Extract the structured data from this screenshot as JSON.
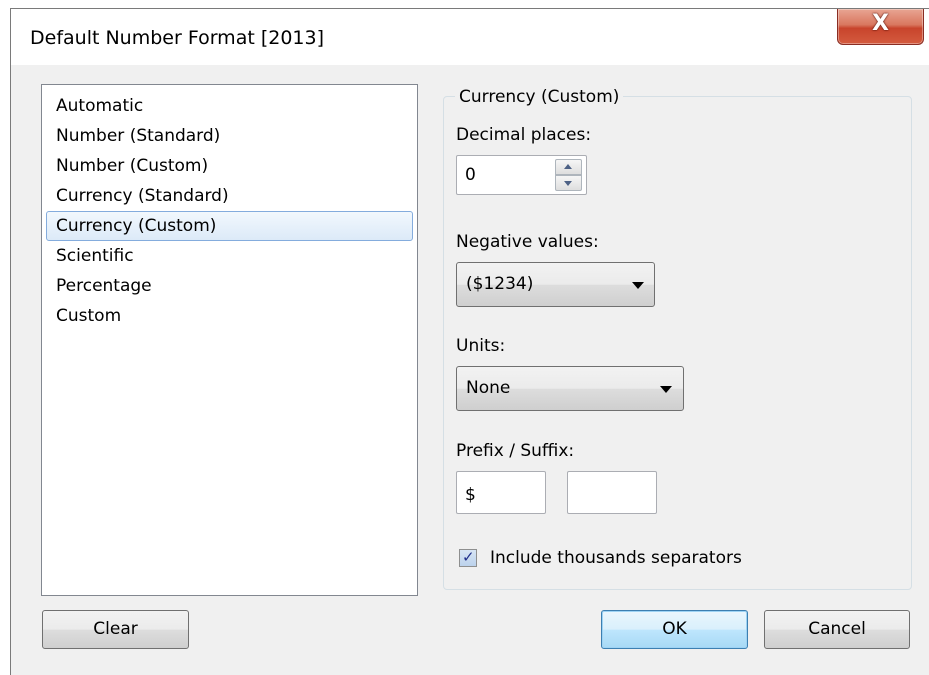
{
  "window": {
    "title": "Default Number Format [2013]",
    "close_glyph": "X"
  },
  "format_list": {
    "items": [
      {
        "label": "Automatic"
      },
      {
        "label": "Number (Standard)"
      },
      {
        "label": "Number (Custom)"
      },
      {
        "label": "Currency (Standard)"
      },
      {
        "label": "Currency (Custom)"
      },
      {
        "label": "Scientific"
      },
      {
        "label": "Percentage"
      },
      {
        "label": "Custom"
      }
    ],
    "selected": "Currency (Custom)"
  },
  "options": {
    "group_title": "Currency (Custom)",
    "decimal_places": {
      "label": "Decimal places:",
      "value": "0"
    },
    "negative_values": {
      "label": "Negative values:",
      "selected": "($1234)"
    },
    "units": {
      "label": "Units:",
      "selected": "None"
    },
    "prefix_suffix": {
      "label": "Prefix / Suffix:",
      "prefix": "$",
      "suffix": ""
    },
    "thousands_separators": {
      "label": "Include thousands separators",
      "checked": true,
      "check_glyph": "✓"
    }
  },
  "buttons": {
    "clear": "Clear",
    "ok": "OK",
    "cancel": "Cancel"
  },
  "icons": {
    "close": "close-icon",
    "spin_up": "chevron-up-icon",
    "spin_down": "chevron-down-icon",
    "dropdown": "dropdown-arrow-icon",
    "check": "checkmark-icon"
  },
  "colors": {
    "window_bg": "#f0f0f0",
    "close_button": "#c8442c",
    "selection_border": "#84acdd",
    "default_button_border": "#3c7fb1"
  }
}
